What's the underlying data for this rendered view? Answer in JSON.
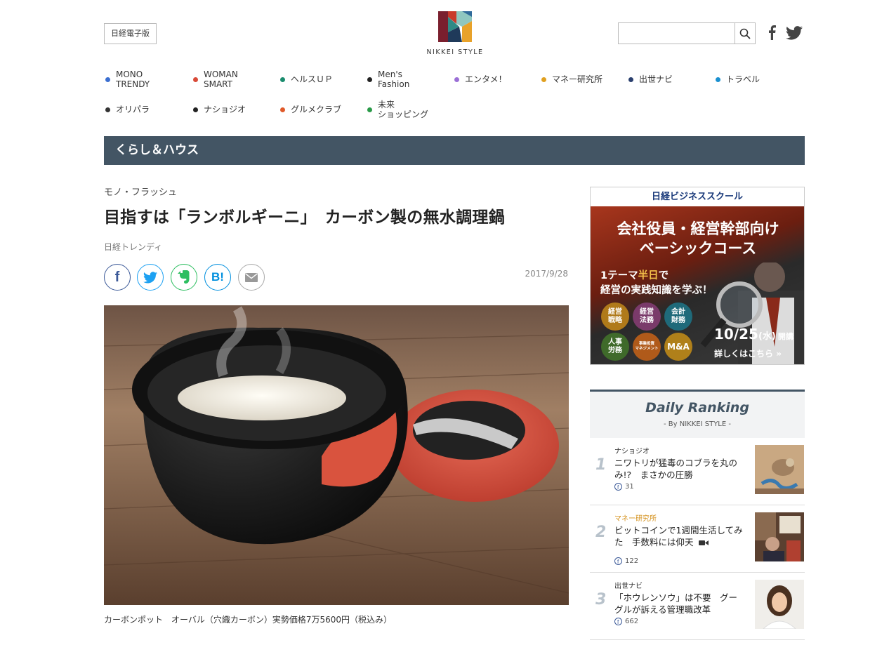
{
  "header": {
    "digital_btn": "日経電子版",
    "logo_text": "NIKKEI STYLE",
    "search_placeholder": ""
  },
  "nav": [
    {
      "label": "MONO\nTRENDY",
      "color": "#3b6fd1"
    },
    {
      "label": "WOMAN\nSMART",
      "color": "#d94a38"
    },
    {
      "label": "ヘルスＵＰ",
      "color": "#1a8c6e"
    },
    {
      "label": "Men's\nFashion",
      "color": "#222222"
    },
    {
      "label": "エンタメ！",
      "color": "#9b6fd6"
    },
    {
      "label": "マネー研究所",
      "color": "#e0a020"
    },
    {
      "label": "出世ナビ",
      "color": "#2a3f6e"
    },
    {
      "label": "トラベル",
      "color": "#1a90d0"
    },
    {
      "label": "オリパラ",
      "color": "#333333"
    },
    {
      "label": "ナショジオ",
      "color": "#222222"
    },
    {
      "label": "グルメクラブ",
      "color": "#e05a2a"
    },
    {
      "label": "未来\nショッピング",
      "color": "#2a9a48"
    }
  ],
  "section": "くらし＆ハウス",
  "article": {
    "category": "モノ・フラッシュ",
    "title": "目指すは「ランボルギーニ」　カーボン製の無水調理鍋",
    "source": "日経トレンディ",
    "date": "2017/9/28",
    "caption": "カーボンポット　オーバル（穴織カーボン）実勢価格7万5600円（税込み）",
    "share": [
      {
        "name": "facebook",
        "label": "f",
        "color": "#3b5998"
      },
      {
        "name": "twitter",
        "label": "",
        "color": "#1da1f2"
      },
      {
        "name": "evernote",
        "label": "",
        "color": "#2dbe60"
      },
      {
        "name": "hatena",
        "label": "B!",
        "color": "#008fde"
      },
      {
        "name": "mail",
        "label": "",
        "color": "#888888"
      }
    ]
  },
  "ad": {
    "head": "日経ビジネススクール",
    "title1": "会社役員・経営幹部向け",
    "title2": "ベーシックコース",
    "sub1_a": "1テーマ",
    "sub1_hl": "半日",
    "sub1_b": "で",
    "sub2": "経営の実践知識を学ぶ！",
    "circles": [
      {
        "label": "経営\n戦略",
        "color": "#b07a1a"
      },
      {
        "label": "経営\n法務",
        "color": "#7a3a6a"
      },
      {
        "label": "会計\n財務",
        "color": "#1f6a7a"
      },
      {
        "label": "人事\n労務",
        "color": "#3f6a2a"
      },
      {
        "label": "事業投資\nマネジメント",
        "color": "#b05a1a"
      },
      {
        "label": "M&A",
        "color": "#b0801a"
      }
    ],
    "date": "10/25",
    "dow": "(水)",
    "open": "開講",
    "more": "詳しくはこちら"
  },
  "ranking": {
    "title": "Daily Ranking",
    "by": "- By NIKKEI STYLE -",
    "items": [
      {
        "num": "1",
        "category": "ナショジオ",
        "cat_color": "#333333",
        "text": "ニワトリが猛毒のコブラを丸のみ!?　まさかの圧勝",
        "count": "31",
        "video": false
      },
      {
        "num": "2",
        "category": "マネー研究所",
        "cat_color": "#d4901a",
        "text": "ビットコインで1週間生活してみた　手数料には仰天",
        "count": "122",
        "video": true
      },
      {
        "num": "3",
        "category": "出世ナビ",
        "cat_color": "#333333",
        "text": "「ホウレンソウ」は不要　グーグルが訴える管理職改革",
        "count": "662",
        "video": false
      }
    ]
  }
}
